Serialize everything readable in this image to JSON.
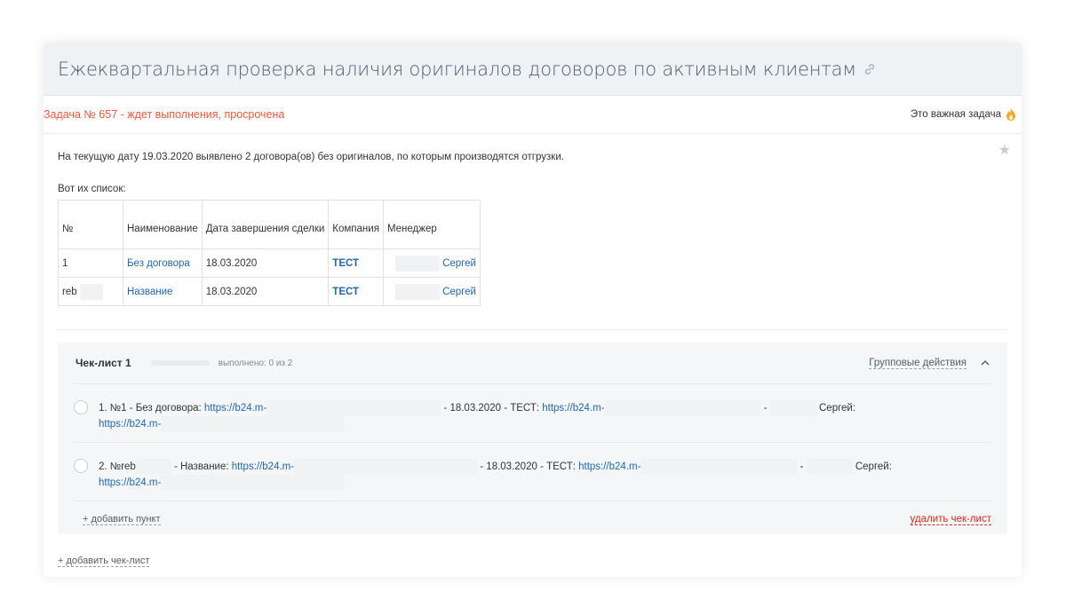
{
  "task": {
    "title": "Ежеквартальная проверка наличия оригиналов договоров по активным клиентам",
    "status": "Задача № 657 - ждет выполнения, просрочена",
    "important_label": "Это важная задача",
    "description": "На текущую дату 19.03.2020 выявлено 2 договора(ов) без оригиналов, по которым производятся отгрузки.",
    "list_heading": "Вот их список:"
  },
  "table": {
    "headers": [
      "№",
      "Наименование",
      "Дата завершения сделки",
      "Компания",
      "Менеджер"
    ],
    "rows": [
      {
        "num": "1",
        "name": "Без договора",
        "date": "18.03.2020",
        "company": "ТЕСТ",
        "manager": "Сергей"
      },
      {
        "num": "reb",
        "name": "Название",
        "date": "18.03.2020",
        "company": "ТЕСТ",
        "manager": "Сергей"
      }
    ]
  },
  "checklist": {
    "title": "Чек-лист 1",
    "progress": "выполнено: 0 из 2",
    "progress_fraction": 0,
    "group_actions": "Групповые действия",
    "items": [
      {
        "p1": "1. №1 - Без договора: ",
        "link1": "https://b24.m-",
        "p2": " - 18.03.2020 - ТЕСТ: ",
        "link2": "https://b24.m-",
        "p3": " - ",
        "p4": "Сергей:",
        "link3": "https://b24.m-"
      },
      {
        "p1": "2. №reb",
        "p1b": " - Название: ",
        "link1": "https://b24.m-",
        "p2": " - 18.03.2020 - ТЕСТ: ",
        "link2": "https://b24.m-",
        "p3": " - ",
        "p4": "Сергей:",
        "link3": "https://b24.m-"
      }
    ],
    "add_item": "+ добавить пункт",
    "delete": "удалить чек-лист"
  },
  "add_checklist": "+ добавить чек-лист",
  "colors": {
    "status_red": "#f0593a",
    "link_blue": "#2067b0",
    "delete_red": "#d6291c",
    "title_bar_bg": "#eef2f4"
  },
  "icons": [
    "link-icon",
    "fire-icon",
    "star-icon",
    "checkbox-circle",
    "chevron-up-icon"
  ]
}
